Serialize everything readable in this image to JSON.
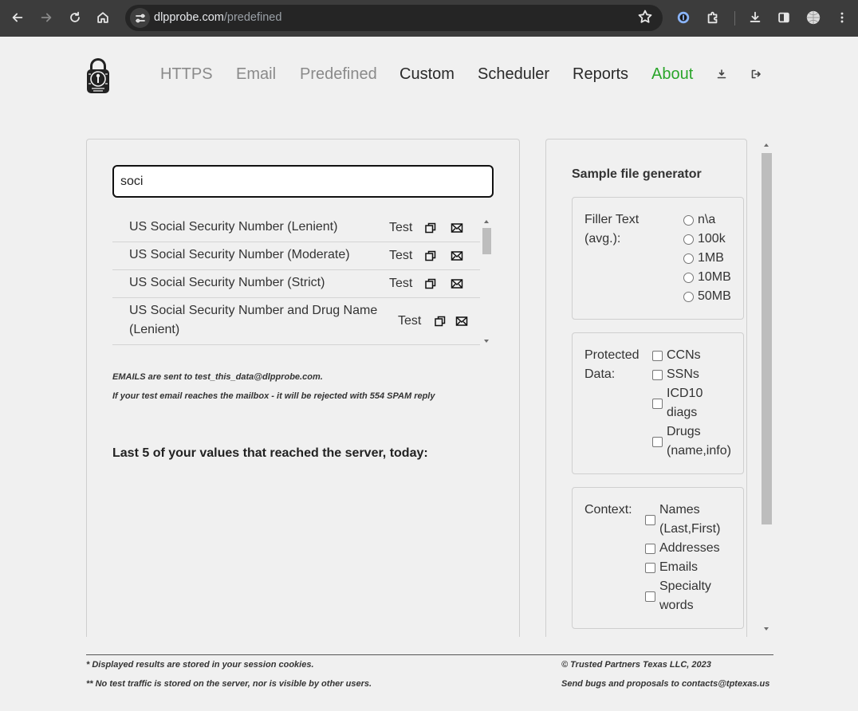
{
  "browser": {
    "url_host": "dlpprobe.com",
    "url_path": "/predefined"
  },
  "nav": {
    "links": [
      {
        "label": "HTTPS",
        "color": "#8a8a8a"
      },
      {
        "label": "Email",
        "color": "#8a8a8a"
      },
      {
        "label": "Predefined",
        "color": "#8a8a8a"
      },
      {
        "label": "Custom",
        "color": "#2a2a2a"
      },
      {
        "label": "Scheduler",
        "color": "#2a2a2a"
      },
      {
        "label": "Reports",
        "color": "#2a2a2a"
      },
      {
        "label": "About",
        "color": "#2aa52a"
      }
    ]
  },
  "search": {
    "value": "soci"
  },
  "results": [
    {
      "name": "US Social Security Number (Lenient)",
      "action": "Test"
    },
    {
      "name": "US Social Security Number (Moderate)",
      "action": "Test"
    },
    {
      "name": "US Social Security Number (Strict)",
      "action": "Test"
    },
    {
      "name": "US Social Security Number and Drug Name (Lenient)",
      "action": "Test"
    }
  ],
  "notes": {
    "emails": "EMAILS are sent to test_this_data@dlpprobe.com.",
    "spam": "If your test email reaches the mailbox - it will be rejected with 554 SPAM reply"
  },
  "last5_heading": "Last 5 of your values that reached the server, today:",
  "generator": {
    "title": "Sample file generator",
    "filler": {
      "label": "Filler Text (avg.):",
      "options": [
        "n\\a",
        "100k",
        "1MB",
        "10MB",
        "50MB"
      ]
    },
    "protected": {
      "label": "Protected Data:",
      "options": [
        "CCNs",
        "SSNs",
        "ICD10 diags",
        "Drugs (name,info)"
      ]
    },
    "context": {
      "label": "Context:",
      "options": [
        "Names (Last,First)",
        "Addresses",
        "Emails",
        "Specialty words"
      ]
    }
  },
  "footer": {
    "cookies": "* Displayed results are stored in your session cookies.",
    "traffic": "** No test traffic is stored on the server, nor is visible by other users.",
    "copyright": "© Trusted Partners Texas LLC, 2023",
    "contact": "Send bugs and proposals to contacts@tptexas.us"
  }
}
